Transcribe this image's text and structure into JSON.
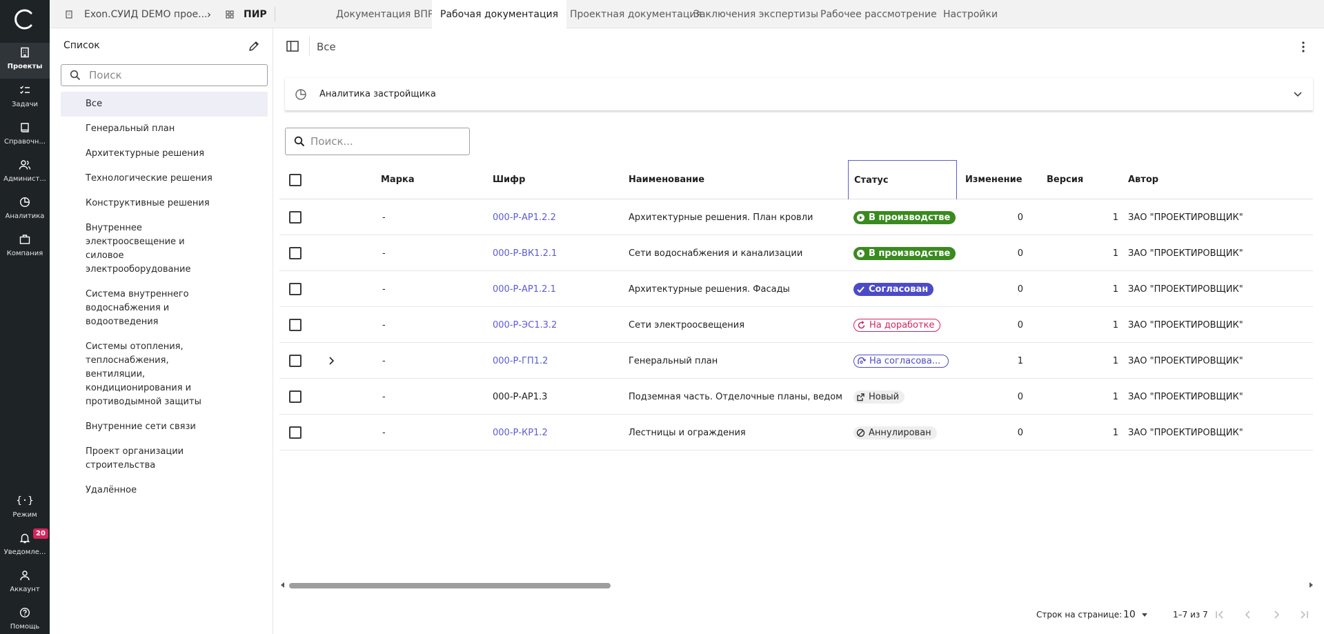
{
  "rail": {
    "items": [
      {
        "label": "Проекты",
        "icon": "projects-icon"
      },
      {
        "label": "Задачи",
        "icon": "tasks-icon"
      },
      {
        "label": "Справочн...",
        "icon": "book-icon"
      },
      {
        "label": "Админист...",
        "icon": "admin-icon"
      },
      {
        "label": "Аналитика",
        "icon": "analytics-icon"
      },
      {
        "label": "Компания",
        "icon": "company-icon"
      }
    ],
    "bottom": [
      {
        "label": "Режим",
        "icon": "code-braces-icon"
      },
      {
        "label": "Уведомле...",
        "icon": "bell-icon",
        "badge": "20"
      },
      {
        "label": "Аккаунт",
        "icon": "account-icon"
      },
      {
        "label": "Помощь",
        "icon": "help-icon"
      }
    ]
  },
  "topbar": {
    "project": "Exon.СУИД DEMO прое...",
    "separator": "›",
    "section": "ПИР",
    "tabs": [
      {
        "label": "Документация ВПР",
        "active": false
      },
      {
        "label": "Рабочая документация",
        "active": true
      },
      {
        "label": "Проектная документация",
        "active": false
      },
      {
        "label": "Заключения экспертизы",
        "active": false
      },
      {
        "label": "Рабочее рассмотрение",
        "active": false
      },
      {
        "label": "Настройки",
        "active": false
      }
    ]
  },
  "list": {
    "title": "Список",
    "search_placeholder": "Поиск",
    "items": [
      {
        "label": "Все",
        "active": true
      },
      {
        "label": "Генеральный план"
      },
      {
        "label": "Архитектурные решения"
      },
      {
        "label": "Технологические решения"
      },
      {
        "label": "Конструктивные решения"
      },
      {
        "label": "Внутреннее электроосвещение и силовое электрооборудование"
      },
      {
        "label": "Система внутреннего водоснабжения и водоотведения"
      },
      {
        "label": "Системы отопления, теплоснабжения, вентиляции, кондиционирования и противодымной защиты"
      },
      {
        "label": "Внутренние сети связи"
      },
      {
        "label": "Проект организации строительства"
      },
      {
        "label": "Удалённое"
      }
    ]
  },
  "main": {
    "title": "Все",
    "accordion_title": "Аналитика застройщика",
    "search_placeholder": "Поиск...",
    "columns": {
      "marka": "Марка",
      "shifr": "Шифр",
      "name": "Наименование",
      "status": "Статус",
      "change": "Изменение",
      "version": "Версия",
      "author": "Автор"
    },
    "rows": [
      {
        "marka": "-",
        "shifr": "000-Р-АР1.2.2",
        "link": true,
        "name": "Архитектурные решения. План кровли",
        "status": "В производстве",
        "status_kind": "green",
        "change": "0",
        "version": "1",
        "author": "ЗАО \"ПРОЕКТИРОВЩИК\"",
        "expandable": false
      },
      {
        "marka": "-",
        "shifr": "000-Р-ВК1.2.1",
        "link": true,
        "name": "Сети водоснабжения и канализации",
        "status": "В производстве",
        "status_kind": "green",
        "change": "0",
        "version": "1",
        "author": "ЗАО \"ПРОЕКТИРОВЩИК\"",
        "expandable": false
      },
      {
        "marka": "-",
        "shifr": "000-Р-АР1.2.1",
        "link": true,
        "name": "Архитектурные решения. Фасады",
        "status": "Согласован",
        "status_kind": "purple",
        "change": "0",
        "version": "1",
        "author": "ЗАО \"ПРОЕКТИРОВЩИК\"",
        "expandable": false
      },
      {
        "marka": "-",
        "shifr": "000-Р-ЭС1.3.2",
        "link": true,
        "name": "Сети электроосвещения",
        "status": "На доработке",
        "status_kind": "red",
        "change": "0",
        "version": "1",
        "author": "ЗАО \"ПРОЕКТИРОВЩИК\"",
        "expandable": false
      },
      {
        "marka": "-",
        "shifr": "000-Р-ГП1.2",
        "link": true,
        "name": "Генеральный план",
        "status": "На согласова...",
        "status_kind": "blue-outline",
        "change": "1",
        "version": "1",
        "author": "ЗАО \"ПРОЕКТИРОВЩИК\"",
        "expandable": true
      },
      {
        "marka": "-",
        "shifr": "000-Р-АР1.3",
        "link": false,
        "name": "Подземная часть. Отделочные планы, ведом...",
        "status": "Новый",
        "status_kind": "gray",
        "change": "0",
        "version": "1",
        "author": "ЗАО \"ПРОЕКТИРОВЩИК\"",
        "expandable": false
      },
      {
        "marka": "-",
        "shifr": "000-Р-КР1.2",
        "link": true,
        "name": "Лестницы и ограждения",
        "status": "Аннулирован",
        "status_kind": "gray",
        "change": "0",
        "version": "1",
        "author": "ЗАО \"ПРОЕКТИРОВЩИК\"",
        "expandable": false
      }
    ],
    "pagination": {
      "rows_label": "Строк на странице:",
      "rows_value": "10",
      "range": "1–7 из 7"
    }
  },
  "colors": {
    "rail_bg": "#1e2326",
    "accent": "#5b5bd6",
    "status_green": "#3a8a1f",
    "status_purple": "#4b4bc8",
    "status_red": "#d3245b",
    "badge": "#d3245b"
  }
}
